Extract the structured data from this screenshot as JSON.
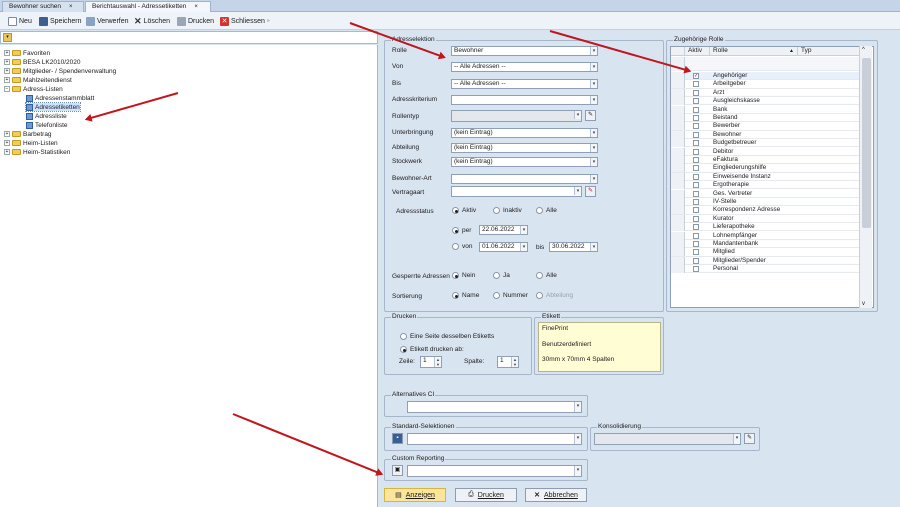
{
  "tabs": [
    {
      "label": "Bewohner suchen"
    },
    {
      "label": "Berichtauswahl - Adressetiketten"
    }
  ],
  "toolbar": {
    "neu": "Neu",
    "speichern": "Speichern",
    "verwerfen": "Verwerfen",
    "loeschen": "Löschen",
    "drucken": "Drucken",
    "schliessen": "Schliessen"
  },
  "tree": [
    {
      "label": "Favoriten"
    },
    {
      "label": "BESA LK2010/2020"
    },
    {
      "label": "Mitglieder- / Spendenverwaltung"
    },
    {
      "label": "Mahlzeitendienst"
    },
    {
      "label": "Adress-Listen"
    },
    {
      "label": "Adressenstammblatt"
    },
    {
      "label": "Adressetiketten"
    },
    {
      "label": "Adressliste"
    },
    {
      "label": "Telefonliste"
    },
    {
      "label": "Barbetrag"
    },
    {
      "label": "Heim-Listen"
    },
    {
      "label": "Heim-Statistiken"
    }
  ],
  "adressselektion": {
    "title": "Adresselektion",
    "rolle_label": "Rolle",
    "rolle": "Bewohner",
    "von_label": "Von",
    "von": "-- Alle Adressen --",
    "bis_label": "Bis",
    "bis": "-- Alle Adressen --",
    "kriterium_label": "Adresskriterium",
    "rollentyp_label": "Rollentyp",
    "unterbringung_label": "Unterbringung",
    "unterbringung": "(kein Eintrag)",
    "abteilung_label": "Abteilung",
    "abteilung": "(kein Eintrag)",
    "stockwerk_label": "Stockwerk",
    "stockwerk": "(kein Eintrag)",
    "art_label": "Bewohner-Art",
    "vertragsart_label": "Vertragaart",
    "status_label": "Adressstatus",
    "aktiv": "Aktiv",
    "inaktiv": "Inaktiv",
    "alle": "Alle",
    "per": "per",
    "per_date": "22.06.2022",
    "von_r": "von",
    "von_date": "01.06.2022",
    "bis_r": "bis",
    "bis_date": "30.06.2022",
    "gesperrt_label": "Gesperrte Adressen",
    "nein": "Nein",
    "ja": "Ja",
    "alle2": "Alle",
    "sort_label": "Sortierung",
    "name": "Name",
    "nummer": "Nummer",
    "abteilung_r": "Abteilung"
  },
  "rollen": {
    "title": "Zugehörige Rolle",
    "col_aktiv": "Aktiv",
    "col_rolle": "Rolle",
    "col_typ": "Typ",
    "rows": [
      {
        "name": "Angehöriger",
        "checked": "✓"
      },
      {
        "name": "Arbeitgeber",
        "checked": ""
      },
      {
        "name": "Arzt",
        "checked": ""
      },
      {
        "name": "Ausgleichskasse",
        "checked": ""
      },
      {
        "name": "Bank",
        "checked": ""
      },
      {
        "name": "Beistand",
        "checked": ""
      },
      {
        "name": "Bewerber",
        "checked": ""
      },
      {
        "name": "Bewohner",
        "checked": ""
      },
      {
        "name": "Budgetbetreuer",
        "checked": ""
      },
      {
        "name": "Debitor",
        "checked": ""
      },
      {
        "name": "eFaktura",
        "checked": ""
      },
      {
        "name": "Eingliederungshilfe",
        "checked": ""
      },
      {
        "name": "Einweisende Instanz",
        "checked": ""
      },
      {
        "name": "Ergotherapie",
        "checked": ""
      },
      {
        "name": "Ges. Vertreter",
        "checked": ""
      },
      {
        "name": "IV-Stelle",
        "checked": ""
      },
      {
        "name": "Korrespondenz Adresse",
        "checked": ""
      },
      {
        "name": "Kurator",
        "checked": ""
      },
      {
        "name": "Lieferapotheke",
        "checked": ""
      },
      {
        "name": "Lohnempfänger",
        "checked": ""
      },
      {
        "name": "Mandantenbank",
        "checked": ""
      },
      {
        "name": "Mitglied",
        "checked": ""
      },
      {
        "name": "Mitglieder/Spender",
        "checked": ""
      },
      {
        "name": "Personal",
        "checked": ""
      }
    ]
  },
  "drucken": {
    "title": "Drucken",
    "opt1": "Eine Seite desselben Etiketts",
    "opt2": "Etikett drucken ab:",
    "zeile_label": "Zeile:",
    "zeile": "1",
    "spalte_label": "Spalte:",
    "spalte": "1"
  },
  "etikett": {
    "title": "Etikett",
    "items": [
      "FinePrint",
      "Benutzerdefiniert",
      "30mm x 70mm  4 Spalten"
    ]
  },
  "alt_ci": {
    "title": "Alternatives CI"
  },
  "standard": {
    "title": "Standard-Selektionen"
  },
  "konsolidierung": {
    "title": "Konsolidierung"
  },
  "custom": {
    "title": "Custom Reporting"
  },
  "buttons": {
    "anzeigen": "Anzeigen",
    "drucken": "Drucken",
    "abbrechen": "Abbrechen"
  },
  "colors": {
    "arrow": "#c0161c",
    "accent": "#fbe59a"
  }
}
